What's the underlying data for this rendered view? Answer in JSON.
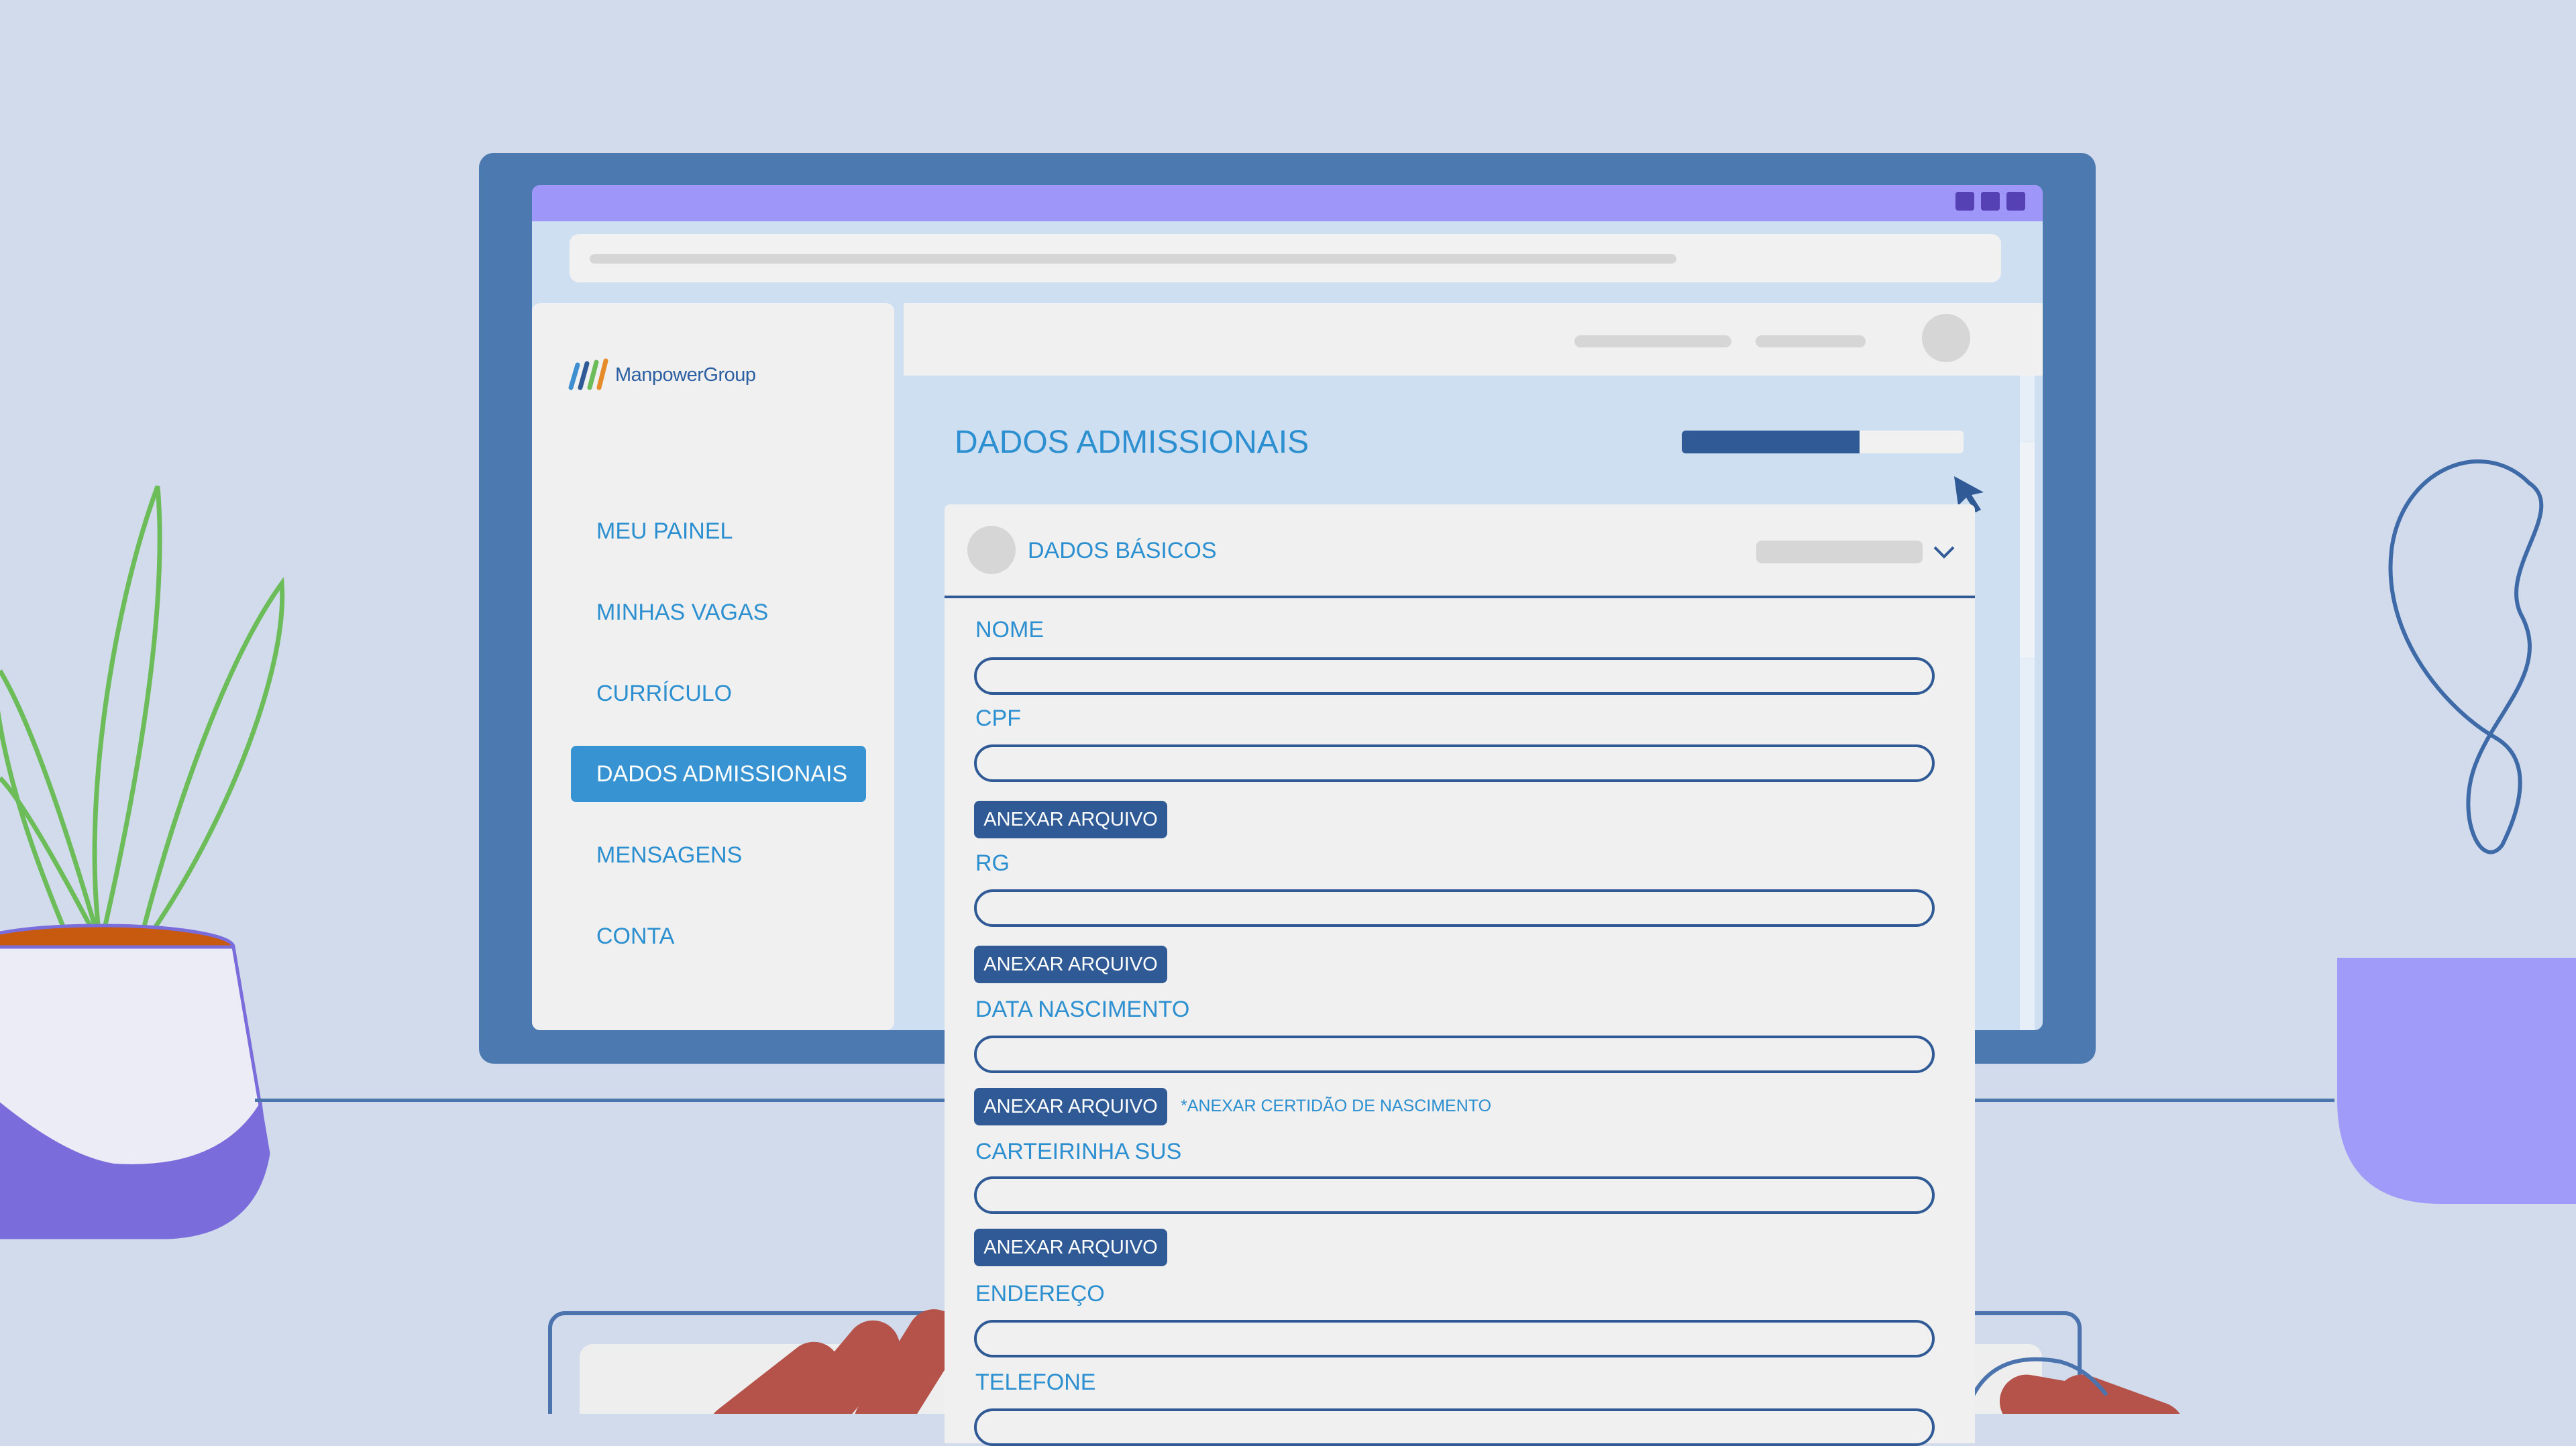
{
  "brand": {
    "name": "ManpowerGroup"
  },
  "sidebar": {
    "items": [
      {
        "label": "MEU PAINEL",
        "active": false
      },
      {
        "label": "MINHAS VAGAS",
        "active": false
      },
      {
        "label": "CURRÍCULO",
        "active": false
      },
      {
        "label": "DADOS ADMISSIONAIS",
        "active": true
      },
      {
        "label": "MENSAGENS",
        "active": false
      },
      {
        "label": "CONTA",
        "active": false
      }
    ]
  },
  "main": {
    "title": "DADOS ADMISSIONAIS",
    "progress": 0.63
  },
  "form": {
    "section_title": "DADOS BÁSICOS",
    "fields": {
      "nome": {
        "label": "NOME",
        "value": ""
      },
      "cpf": {
        "label": "CPF",
        "value": ""
      },
      "rg": {
        "label": "RG",
        "value": ""
      },
      "data_nascimento": {
        "label": "DATA NASCIMENTO",
        "value": ""
      },
      "carteirinha_sus": {
        "label": "CARTEIRINHA SUS",
        "value": ""
      },
      "endereco": {
        "label": "ENDEREÇO",
        "value": ""
      },
      "telefone": {
        "label": "TELEFONE",
        "value": ""
      }
    },
    "attach_label": "ANEXAR ARQUIVO",
    "birth_note": "*ANEXAR CERTIDÃO DE NASCIMENTO"
  },
  "help": {
    "label": "?"
  },
  "colors": {
    "background": "#d1dbec",
    "monitor": "#4d79b1",
    "titlebar": "#9e96f9",
    "accent": "#2c8fd0",
    "active_nav": "#3893d3",
    "button": "#2f5a96",
    "plant_leaf": "#6cbd5a",
    "pot_soil": "#c85a10",
    "hand": "#b5524a"
  },
  "icons": [
    "manpower-logo-icon",
    "chevron-down-icon",
    "cursor-icon",
    "help-icon",
    "window-control-icon"
  ]
}
